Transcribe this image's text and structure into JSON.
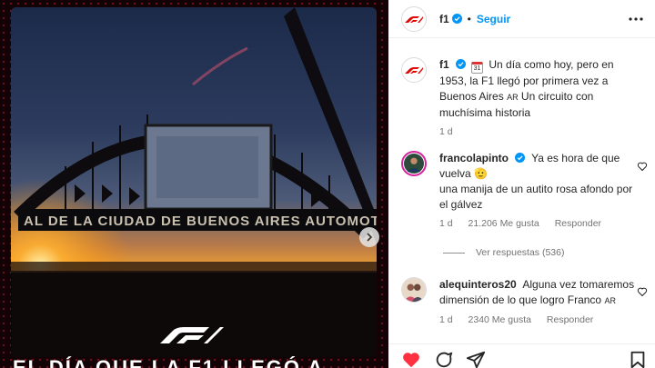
{
  "media": {
    "sign_text": "AL DE LA CIUDAD DE BUENOS AIRES AUTOMOTOR",
    "bottom_text": "EL DÍA QUE LA F1 LLEGÓ A",
    "logo": "f1-logo"
  },
  "header": {
    "username": "f1",
    "separator": "•",
    "follow_label": "Seguir"
  },
  "caption": {
    "username": "f1",
    "text_before": "Un día como hoy, pero en 1953, la F1 llegó por primera vez a Buenos Aires",
    "flag": "AR",
    "text_after": "Un circuito con muchísima historia",
    "calendar_day": "31",
    "time": "1 d"
  },
  "comments": [
    {
      "username": "francolapinto",
      "text_line1": "Ya es hora de que vuelva 🫡",
      "text_line2": "una manija de un autito rosa afondo por el gálvez",
      "time": "1 d",
      "likes": "21.206 Me gusta",
      "reply_label": "Responder",
      "view_replies": "Ver respuestas (536)"
    },
    {
      "username": "alequinteros20",
      "text": "Alguna vez tomaremos dimensión de lo que logro Franco",
      "flag": "AR",
      "time": "1 d",
      "likes": "2340 Me gusta",
      "reply_label": "Responder"
    }
  ],
  "icons": {
    "next": "chevron-right-icon",
    "more": "more-horizontal-icon",
    "verified": "verified-badge-icon",
    "like": "heart-icon",
    "comment": "comment-icon",
    "share": "send-icon",
    "save": "bookmark-icon"
  },
  "colors": {
    "accent": "#0095f6",
    "like_red": "#ff3040",
    "f1_red": "#e10600"
  }
}
